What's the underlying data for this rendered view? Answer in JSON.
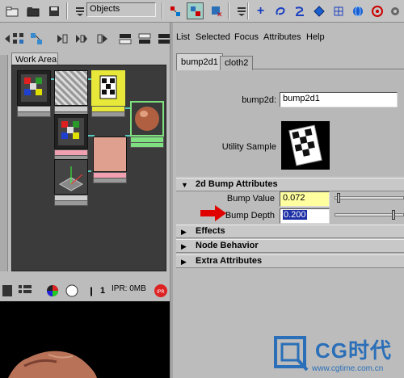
{
  "toolbar": {
    "objects_value": "Objects"
  },
  "left_panel": {
    "work_area_tab": "Work Area",
    "ipr_status": "IPR: 0MB",
    "pause_glyph": "❙",
    "render_divider_glyph": "1"
  },
  "attribute_editor": {
    "menu": [
      "List",
      "Selected",
      "Focus",
      "Attributes",
      "Help"
    ],
    "tabs": [
      "bump2d1",
      "cloth2"
    ],
    "node_type_label": "bump2d:",
    "node_name_value": "bump2d1",
    "utility_sample_label": "Utility Sample",
    "sections": {
      "bump": "2d Bump Attributes",
      "effects": "Effects",
      "node_behavior": "Node Behavior",
      "extra": "Extra Attributes"
    },
    "bump_value_label": "Bump Value",
    "bump_value": "0.072",
    "bump_depth_label": "Bump Depth",
    "bump_depth": "0.200",
    "bump_value_fraction": 0.04,
    "bump_depth_fraction": 0.87
  },
  "watermark": {
    "brand": "CG时代",
    "url": "www.cgtime.com.cn"
  },
  "colors": {
    "accent_blue": "#2a6fb8",
    "connection_cyan": "#58c9c0",
    "arrow_red": "#e00000",
    "selected_field_bg": "#1d2fa5"
  },
  "icons": [
    "folder-open-icon",
    "save-icon",
    "objects-menu-icon",
    "snap-icon",
    "select-icon",
    "move-icon",
    "lasso-icon",
    "curve-icon",
    "sphere-icon",
    "lattice-icon",
    "globe-icon",
    "gear-icon"
  ]
}
